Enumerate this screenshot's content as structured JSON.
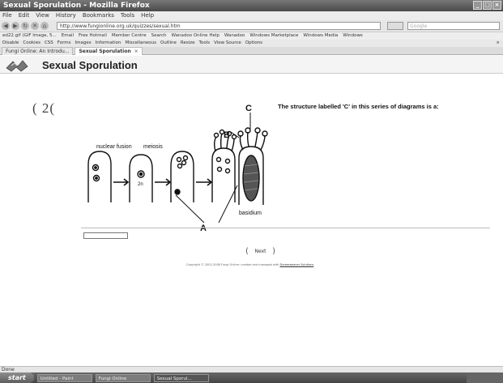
{
  "window": {
    "title": "Sexual Sporulation - Mozilla Firefox",
    "controls": [
      "_",
      "□",
      "×"
    ]
  },
  "menu": [
    "File",
    "Edit",
    "View",
    "History",
    "Bookmarks",
    "Tools",
    "Help"
  ],
  "nav": {
    "url": "http://www.fungionline.org.uk/quizzes/sexual.htm",
    "search_placeholder": "Google"
  },
  "bookmarks": [
    "ed22.gif (GIF Image, 5...",
    "Email",
    "Free Hotmail",
    "Member Centre",
    "Search",
    "Wanadoo Online Help",
    "Wanadoo",
    "Windows Marketplace",
    "Windows Media",
    "Windows"
  ],
  "devbar": [
    "Disable",
    "Cookies",
    "CSS",
    "Forms",
    "Images",
    "Information",
    "Miscellaneous",
    "Outline",
    "Resize",
    "Tools",
    "View Source",
    "Options"
  ],
  "tabs": [
    {
      "label": "Fungi Online: An Introdu...",
      "active": false
    },
    {
      "label": "Sexual Sporulation",
      "active": true
    }
  ],
  "page": {
    "title": "Sexual Sporulation",
    "question_number": "2",
    "question": "The structure labelled 'C' in this series of diagrams is a:",
    "diagram_labels": {
      "nuclear_fusion": "nuclear fusion",
      "meiosis": "meiosis",
      "n2": "2n",
      "a": "A",
      "b": "B",
      "c": "C",
      "basidium": "basidium"
    },
    "next_label": "Next",
    "copyright": "Copyright © 2002-2008 Fungi Online: created and managed with",
    "copyright_link": "Dreamweaver Solutions"
  },
  "status": "Done",
  "taskbar": {
    "start": "start",
    "tasks": [
      "Untitled - Paint",
      "Fungi Online",
      "Sexual Sporul..."
    ]
  }
}
